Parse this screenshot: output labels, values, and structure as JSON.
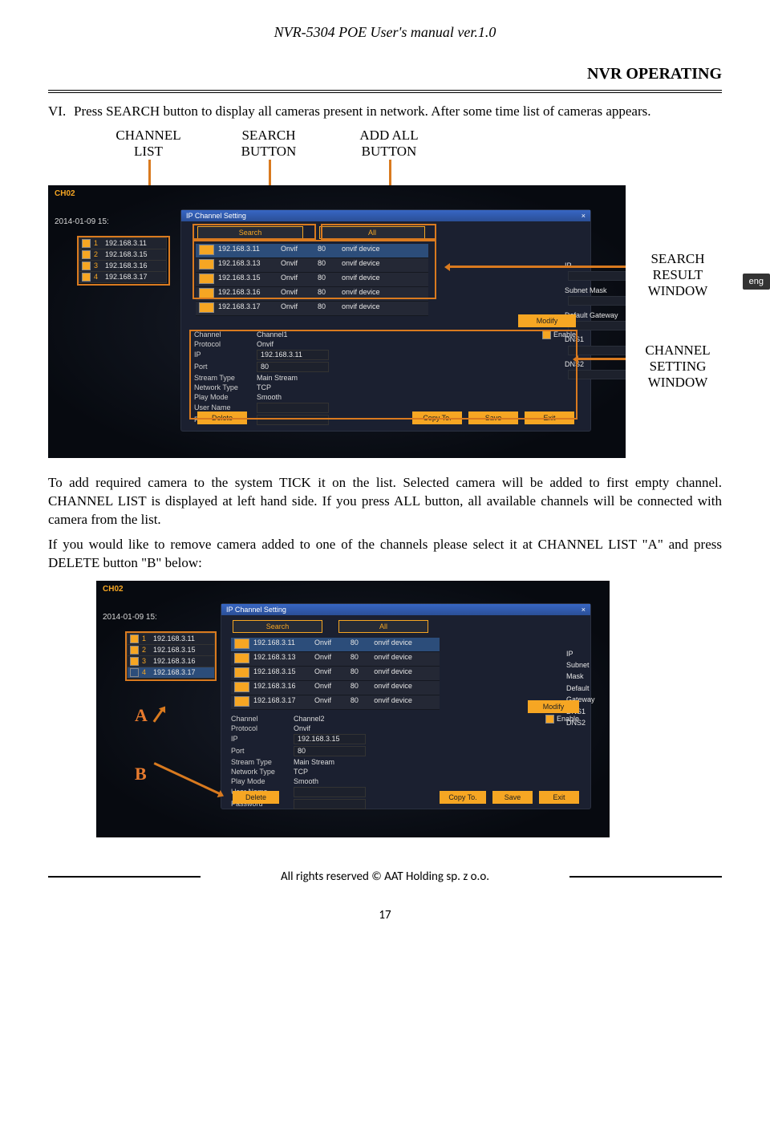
{
  "header_title": "NVR-5304 POE User's manual ver.1.0",
  "section_heading": "NVR OPERATING",
  "item_num": "VI.",
  "item_text": "Press SEARCH button to display all cameras present in network. After some time list of cameras appears.",
  "callout": {
    "channel_list": "CHANNEL LIST",
    "search_button": "SEARCH BUTTON",
    "add_all_button": "ADD ALL BUTTON",
    "search_result_window": "SEARCH RESULT WINDOW",
    "channel_setting_window": "CHANNEL SETTING WINDOW"
  },
  "fig": {
    "corner": "CH02",
    "date": "2014-01-09  15:",
    "dialog_title": "IP Channel Setting",
    "search_btn": "Search",
    "all_btn": "All",
    "channel_list": [
      {
        "n": "1",
        "ip": "192.168.3.11",
        "chk": true
      },
      {
        "n": "2",
        "ip": "192.168.3.15",
        "chk": true
      },
      {
        "n": "3",
        "ip": "192.168.3.16",
        "chk": true
      },
      {
        "n": "4",
        "ip": "192.168.3.17",
        "chk": true
      }
    ],
    "results": [
      {
        "ip": "192.168.3.11",
        "proto": "Onvif",
        "port": "80",
        "dev": "onvif device",
        "sel": true
      },
      {
        "ip": "192.168.3.13",
        "proto": "Onvif",
        "port": "80",
        "dev": "onvif device",
        "sel": false
      },
      {
        "ip": "192.168.3.15",
        "proto": "Onvif",
        "port": "80",
        "dev": "onvif device",
        "sel": false
      },
      {
        "ip": "192.168.3.16",
        "proto": "Onvif",
        "port": "80",
        "dev": "onvif device",
        "sel": false
      },
      {
        "ip": "192.168.3.17",
        "proto": "Onvif",
        "port": "80",
        "dev": "onvif device",
        "sel": false
      }
    ],
    "right_labels": {
      "ip": "IP",
      "subnet": "Subnet Mask",
      "gw": "Default Gateway",
      "dns1": "DNS1",
      "dns2": "DNS2"
    },
    "modify_btn": "Modify",
    "setting": {
      "Channel": "Channel1",
      "Protocol": "Onvif",
      "IP": "192.168.3.11",
      "Port": "80",
      "Stream Type": "Main Stream",
      "Network Type": "TCP",
      "Play Mode": "Smooth",
      "User Name": "",
      "Password": ""
    },
    "enable": "Enable",
    "delete_btn": "Delete",
    "copyto_btn": "Copy To.",
    "save_btn": "Save",
    "exit_btn": "Exit"
  },
  "fig2": {
    "setting": {
      "Channel": "Channel2",
      "Protocol": "Onvif",
      "IP": "192.168.3.15",
      "Port": "80",
      "Stream Type": "Main Stream",
      "Network Type": "TCP",
      "Play Mode": "Smooth",
      "User Name": "",
      "Password": ""
    },
    "channel_list": [
      {
        "n": "1",
        "ip": "192.168.3.11",
        "chk": true
      },
      {
        "n": "2",
        "ip": "192.168.3.15",
        "chk": true
      },
      {
        "n": "3",
        "ip": "192.168.3.16",
        "chk": true
      },
      {
        "n": "4",
        "ip": "192.168.3.17",
        "chk": false
      }
    ]
  },
  "para2": "To add required camera to the system TICK it on the list. Selected camera will be added to first empty channel. CHANNEL LIST is displayed at left hand side. If you press ALL button, all available channels will be connected with camera from the list.",
  "para3": "If you would like to remove camera added to one of the channels please select it at CHANNEL LIST \"A\" and press DELETE button \"B\" below:",
  "marker_a": "A",
  "marker_b": "B",
  "lang_tab": "eng",
  "footer": "All rights reserved © AAT Holding sp. z o.o.",
  "page_num": "17"
}
